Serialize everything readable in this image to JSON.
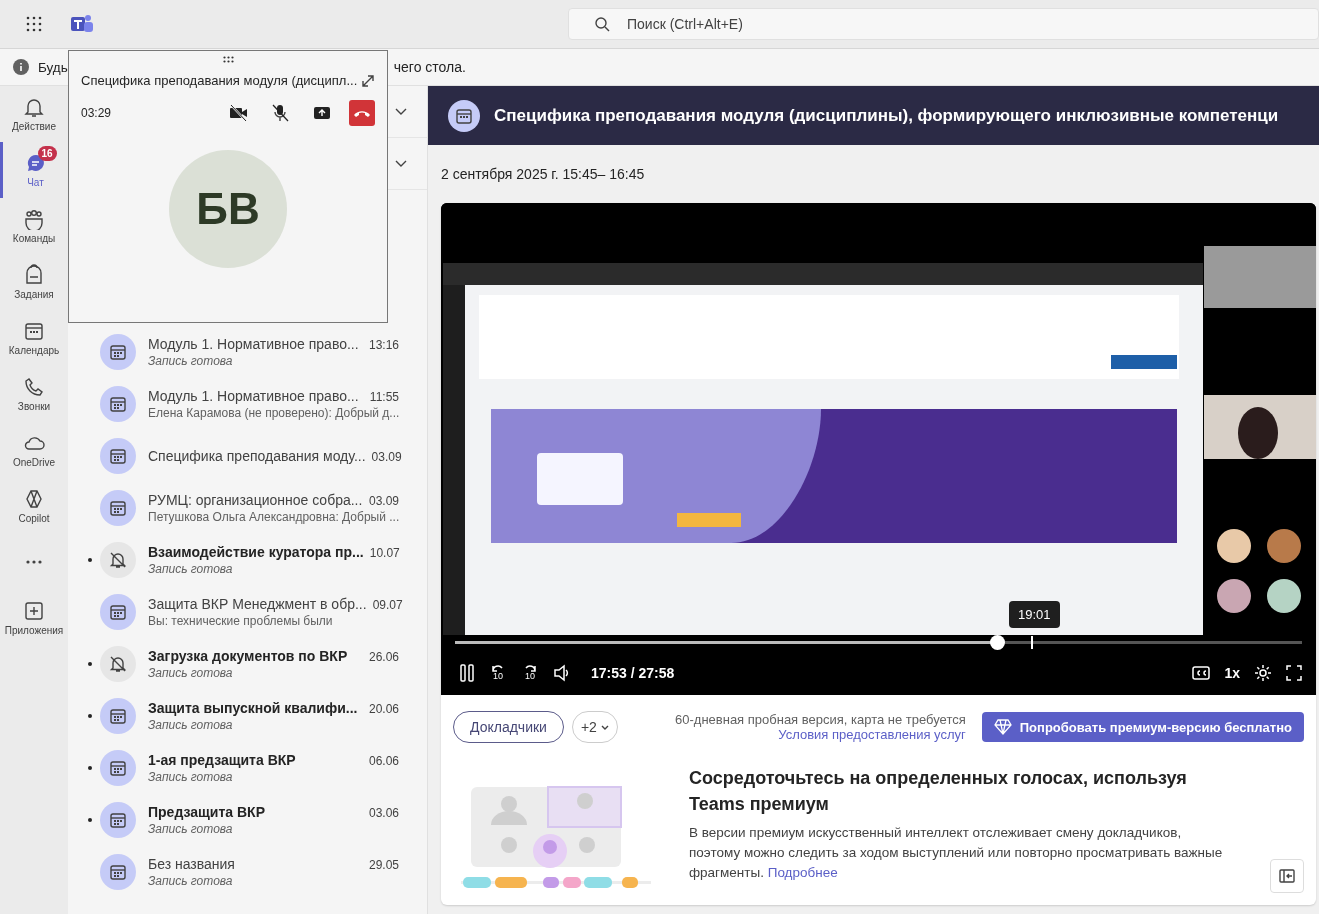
{
  "app_bar": {
    "search": {
      "placeholder": "Поиск (Ctrl+Alt+E)"
    }
  },
  "info_banner": {
    "texts": [
      "Будь",
      "чего стола."
    ]
  },
  "rail": [
    {
      "kind": "bell",
      "label": "Действие",
      "selected": false
    },
    {
      "kind": "chat",
      "label": "Чат",
      "selected": true,
      "badge": "16"
    },
    {
      "kind": "teams",
      "label": "Команды",
      "selected": false
    },
    {
      "kind": "bag",
      "label": "Задания",
      "selected": false
    },
    {
      "kind": "calendar",
      "label": "Календарь",
      "selected": false
    },
    {
      "kind": "phone",
      "label": "Звонки",
      "selected": false
    },
    {
      "kind": "cloud",
      "label": "OneDrive",
      "selected": false
    },
    {
      "kind": "copilot",
      "label": "Copilot",
      "selected": false
    },
    {
      "kind": "more",
      "selected": false
    },
    {
      "kind": "plus",
      "label": "Приложения",
      "selected": false
    }
  ],
  "call_window": {
    "title": "Специфика преподавания модуля (дисципл...",
    "timer": "03:29",
    "initials": "БВ"
  },
  "chat_list": [
    {
      "kind": "meeting",
      "title": "Модуль 1. Нормативное право...",
      "time": "13:16",
      "subtitle": {
        "kind": "status",
        "text": "Запись готова"
      },
      "unread": false
    },
    {
      "kind": "meeting",
      "title": "Модуль 1. Нормативное право...",
      "time": "11:55",
      "subtitle": {
        "kind": "message",
        "text": "Елена Карамова (не проверено): Добрый д..."
      },
      "unread": false
    },
    {
      "kind": "meeting",
      "title": "Специфика преподавания моду...",
      "time": "03.09",
      "unread": false
    },
    {
      "kind": "meeting",
      "title": "РУМЦ: организационное собра...",
      "time": "03.09",
      "subtitle": {
        "kind": "message",
        "text": "Петушкова Ольга Александровна: Добрый ..."
      },
      "unread": false
    },
    {
      "kind": "muted",
      "title": "Взаимодействие куратора пр...",
      "time": "10.07",
      "subtitle": {
        "kind": "status",
        "text": "Запись готова"
      },
      "unread": true
    },
    {
      "kind": "meeting",
      "title": "Защита ВКР Менеджмент в обр...",
      "time": "09.07",
      "subtitle": {
        "kind": "message",
        "text": "Вы: технические проблемы были"
      },
      "unread": false
    },
    {
      "kind": "muted",
      "title": "Загрузка документов по ВКР",
      "time": "26.06",
      "subtitle": {
        "kind": "status",
        "text": "Запись готова"
      },
      "unread": true
    },
    {
      "kind": "meeting",
      "title": "Защита выпускной квалифи...",
      "time": "20.06",
      "subtitle": {
        "kind": "status",
        "text": "Запись готова"
      },
      "unread": true
    },
    {
      "kind": "meeting",
      "title": "1-ая предзащита ВКР",
      "time": "06.06",
      "subtitle": {
        "kind": "status",
        "text": "Запись готова"
      },
      "unread": true
    },
    {
      "kind": "meeting",
      "title": "Предзащита ВКР",
      "time": "03.06",
      "subtitle": {
        "kind": "status",
        "text": "Запись готова"
      },
      "unread": true
    },
    {
      "kind": "meeting",
      "title": "Без названия",
      "time": "29.05",
      "subtitle": {
        "kind": "status",
        "text": "Запись готова"
      },
      "unread": false
    }
  ],
  "meeting": {
    "title": "Специфика преподавания модуля (дисциплины), формирующего инклюзивные компетенци",
    "date": "2 сентября 2025 г. 15:45– 16:45"
  },
  "player": {
    "kind": "picture",
    "tooltip": "19:01",
    "level": 0.64,
    "playing": true,
    "skip_back": "10",
    "skip_forward": "10",
    "time": "17:53 / 27:58",
    "speed": "1x"
  },
  "speakers": {
    "button": "Докладчики",
    "more": "+2"
  },
  "premium": {
    "trial_note": "60-дневная пробная версия, карта не требуется",
    "terms_link": "Условия предоставления услуг",
    "button": "Попробовать премиум-версию бесплатно",
    "heading": "Сосредоточьтесь на определенных голосах, используя Teams премиум",
    "body": "В версии премиум искусственный интеллект отслеживает смену докладчиков, поэтому можно следить за ходом выступлений или повторно просматривать важные фрагменты.",
    "more_link": "Подробнее"
  }
}
